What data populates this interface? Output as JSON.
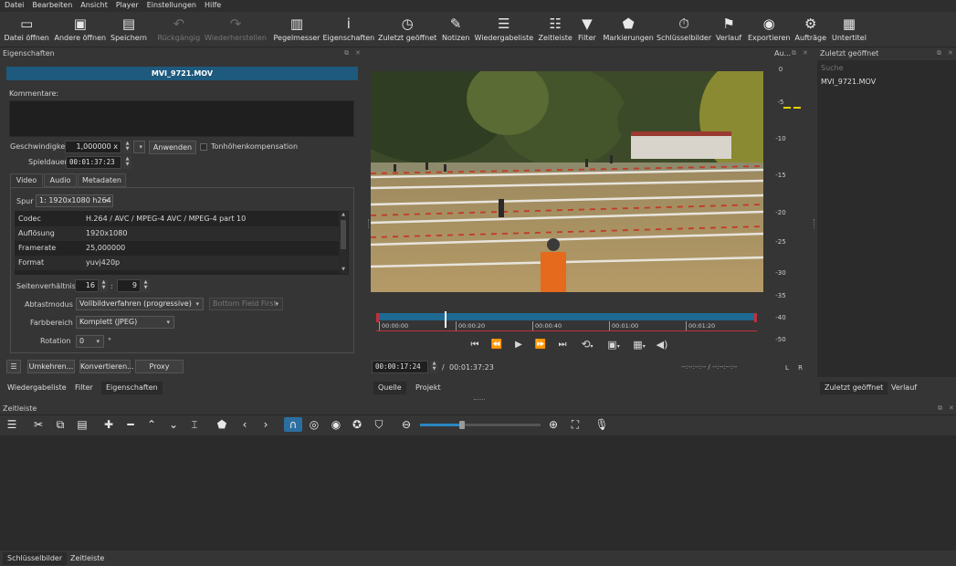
{
  "menu": [
    "Datei",
    "Bearbeiten",
    "Ansicht",
    "Player",
    "Einstellungen",
    "Hilfe"
  ],
  "toolbar": [
    {
      "label": "Datei öffnen",
      "icon": "open-folder-icon",
      "glyph": "▭",
      "disabled": false
    },
    {
      "label": "Andere öffnen",
      "icon": "open-other-icon",
      "glyph": "▣",
      "disabled": false
    },
    {
      "label": "Speichern",
      "icon": "save-icon",
      "glyph": "▤",
      "disabled": false
    },
    {
      "label": "Rückgängig",
      "icon": "undo-icon",
      "glyph": "↶",
      "disabled": true
    },
    {
      "label": "Wiederherstellen",
      "icon": "redo-icon",
      "glyph": "↷",
      "disabled": true
    },
    {
      "label": "Pegelmesser",
      "icon": "peak-meter-icon",
      "glyph": "▥",
      "disabled": false
    },
    {
      "label": "Eigenschaften",
      "icon": "info-icon",
      "glyph": "i",
      "disabled": false
    },
    {
      "label": "Zuletzt geöffnet",
      "icon": "clock-icon",
      "glyph": "◷",
      "disabled": false
    },
    {
      "label": "Notizen",
      "icon": "notes-icon",
      "glyph": "✎",
      "disabled": false
    },
    {
      "label": "Wiedergabeliste",
      "icon": "playlist-icon",
      "glyph": "☰",
      "disabled": false
    },
    {
      "label": "Zeitleiste",
      "icon": "timeline-icon",
      "glyph": "☷",
      "disabled": false
    },
    {
      "label": "Filter",
      "icon": "filter-icon",
      "glyph": "▼",
      "disabled": false
    },
    {
      "label": "Markierungen",
      "icon": "marker-icon",
      "glyph": "⬟",
      "disabled": false
    },
    {
      "label": "Schlüsselbilder",
      "icon": "stopwatch-icon",
      "glyph": "⏱",
      "disabled": false
    },
    {
      "label": "Verlauf",
      "icon": "history-icon",
      "glyph": "⚑",
      "disabled": false
    },
    {
      "label": "Exportieren",
      "icon": "export-icon",
      "glyph": "◉",
      "disabled": false
    },
    {
      "label": "Aufträge",
      "icon": "jobs-gear-icon",
      "glyph": "⚙",
      "disabled": false
    },
    {
      "label": "Untertitel",
      "icon": "subtitles-icon",
      "glyph": "▦",
      "disabled": false
    }
  ],
  "properties": {
    "panel_title": "Eigenschaften",
    "clip_name": "MVI_9721.MOV",
    "comments_label": "Kommentare:",
    "speed_label": "Geschwindigkeit",
    "speed_value": "1,000000 x",
    "apply_label": "Anwenden",
    "pitch_label": "Tonhöhenkompensation",
    "duration_label": "Spieldauer",
    "duration_value": "00:01:37:23",
    "tabs": [
      "Video",
      "Audio",
      "Metadaten"
    ],
    "track_label": "Spur",
    "track_value": "1: 1920x1080 h264",
    "info_rows": [
      {
        "key": "Codec",
        "value": "H.264 / AVC / MPEG-4 AVC / MPEG-4 part 10"
      },
      {
        "key": "Auflösung",
        "value": "1920x1080"
      },
      {
        "key": "Framerate",
        "value": "25,000000"
      },
      {
        "key": "Format",
        "value": "yuvj420p"
      }
    ],
    "aspect_label": "Seitenverhältnis",
    "aspect_w": "16",
    "aspect_sep": ":",
    "aspect_h": "9",
    "scan_label": "Abtastmodus",
    "scan_value": "Vollbildverfahren (progressive)",
    "field_value": "Bottom Field First",
    "range_label": "Farbbereich",
    "range_value": "Komplett (JPEG)",
    "rotation_label": "Rotation",
    "rotation_value": "0",
    "rotation_unit": "°",
    "menu_glyph": "☰",
    "reverse_label": "Umkehren...",
    "convert_label": "Konvertieren...",
    "proxy_label": "Proxy"
  },
  "left_bottom_tabs": [
    "Wiedergabeliste",
    "Filter",
    "Eigenschaften"
  ],
  "player": {
    "ruler": [
      "00:00:00",
      "00:00:20",
      "00:00:40",
      "00:01:00",
      "00:01:20"
    ],
    "playhead_fraction": 0.18,
    "position": "00:00:17:24",
    "separator": "/",
    "total": "00:01:37:23",
    "in_out": "--:--:--:-- / --:--:--:--",
    "tabs": [
      "Quelle",
      "Projekt"
    ],
    "controls": [
      "⏮",
      "⏪",
      "▶",
      "⏩",
      "⏭"
    ],
    "colors": {
      "ruler": "#1e6a93",
      "marker": "#ffffff",
      "inout": "#c0303a"
    }
  },
  "audio_meter": {
    "title": "Au...",
    "scale": [
      "0",
      "-5",
      "-10",
      "-15",
      "-20",
      "-25",
      "-30",
      "-35",
      "-40",
      "-50"
    ],
    "channels": "L R",
    "level_db": -5,
    "color": "#e5d200"
  },
  "recent": {
    "title": "Zuletzt geöffnet",
    "search_placeholder": "Suche",
    "items": [
      "MVI_9721.MOV"
    ],
    "tabs": [
      "Zuletzt geöffnet",
      "Verlauf"
    ]
  },
  "timeline": {
    "title": "Zeitleiste",
    "bottom_tabs": [
      "Schlüsselbilder",
      "Zeitleiste"
    ],
    "zoom_fraction": 0.35
  },
  "colors": {
    "accent": "#1d5a7e",
    "selected_tab": "#2b2b2b"
  }
}
